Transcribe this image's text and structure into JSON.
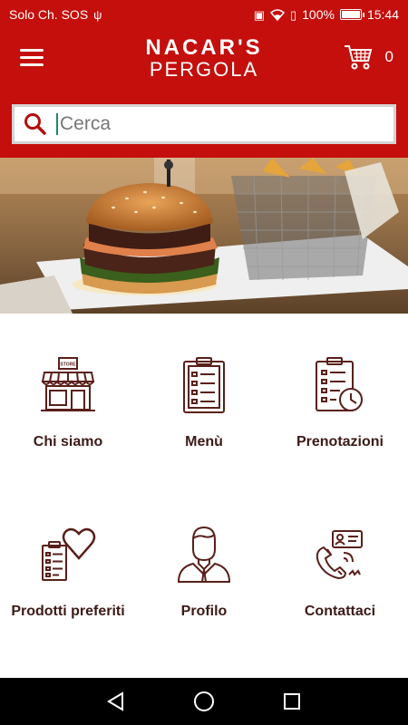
{
  "status_bar": {
    "carrier": "Solo Ch. SOS",
    "battery_percent": "100%",
    "battery_level": 1.0,
    "time": "15:44"
  },
  "header": {
    "logo_line1": "NACAR'S",
    "logo_line2": "PERGOLA",
    "cart_count": "0",
    "brand_color": "#c40f0c"
  },
  "search": {
    "placeholder": "Cerca"
  },
  "tiles": [
    {
      "label": "Chi siamo",
      "icon": "store-icon"
    },
    {
      "label": "Menù",
      "icon": "clipboard-list-icon"
    },
    {
      "label": "Prenotazioni",
      "icon": "clipboard-clock-icon"
    },
    {
      "label": "Prodotti preferiti",
      "icon": "clipboard-heart-icon"
    },
    {
      "label": "Profilo",
      "icon": "user-icon"
    },
    {
      "label": "Contattaci",
      "icon": "phone-contact-icon"
    }
  ],
  "icon_color": "#5a1f1a",
  "store_sign": "STORE",
  "nav": {
    "back": "back-icon",
    "home": "home-icon",
    "recents": "recents-icon"
  }
}
